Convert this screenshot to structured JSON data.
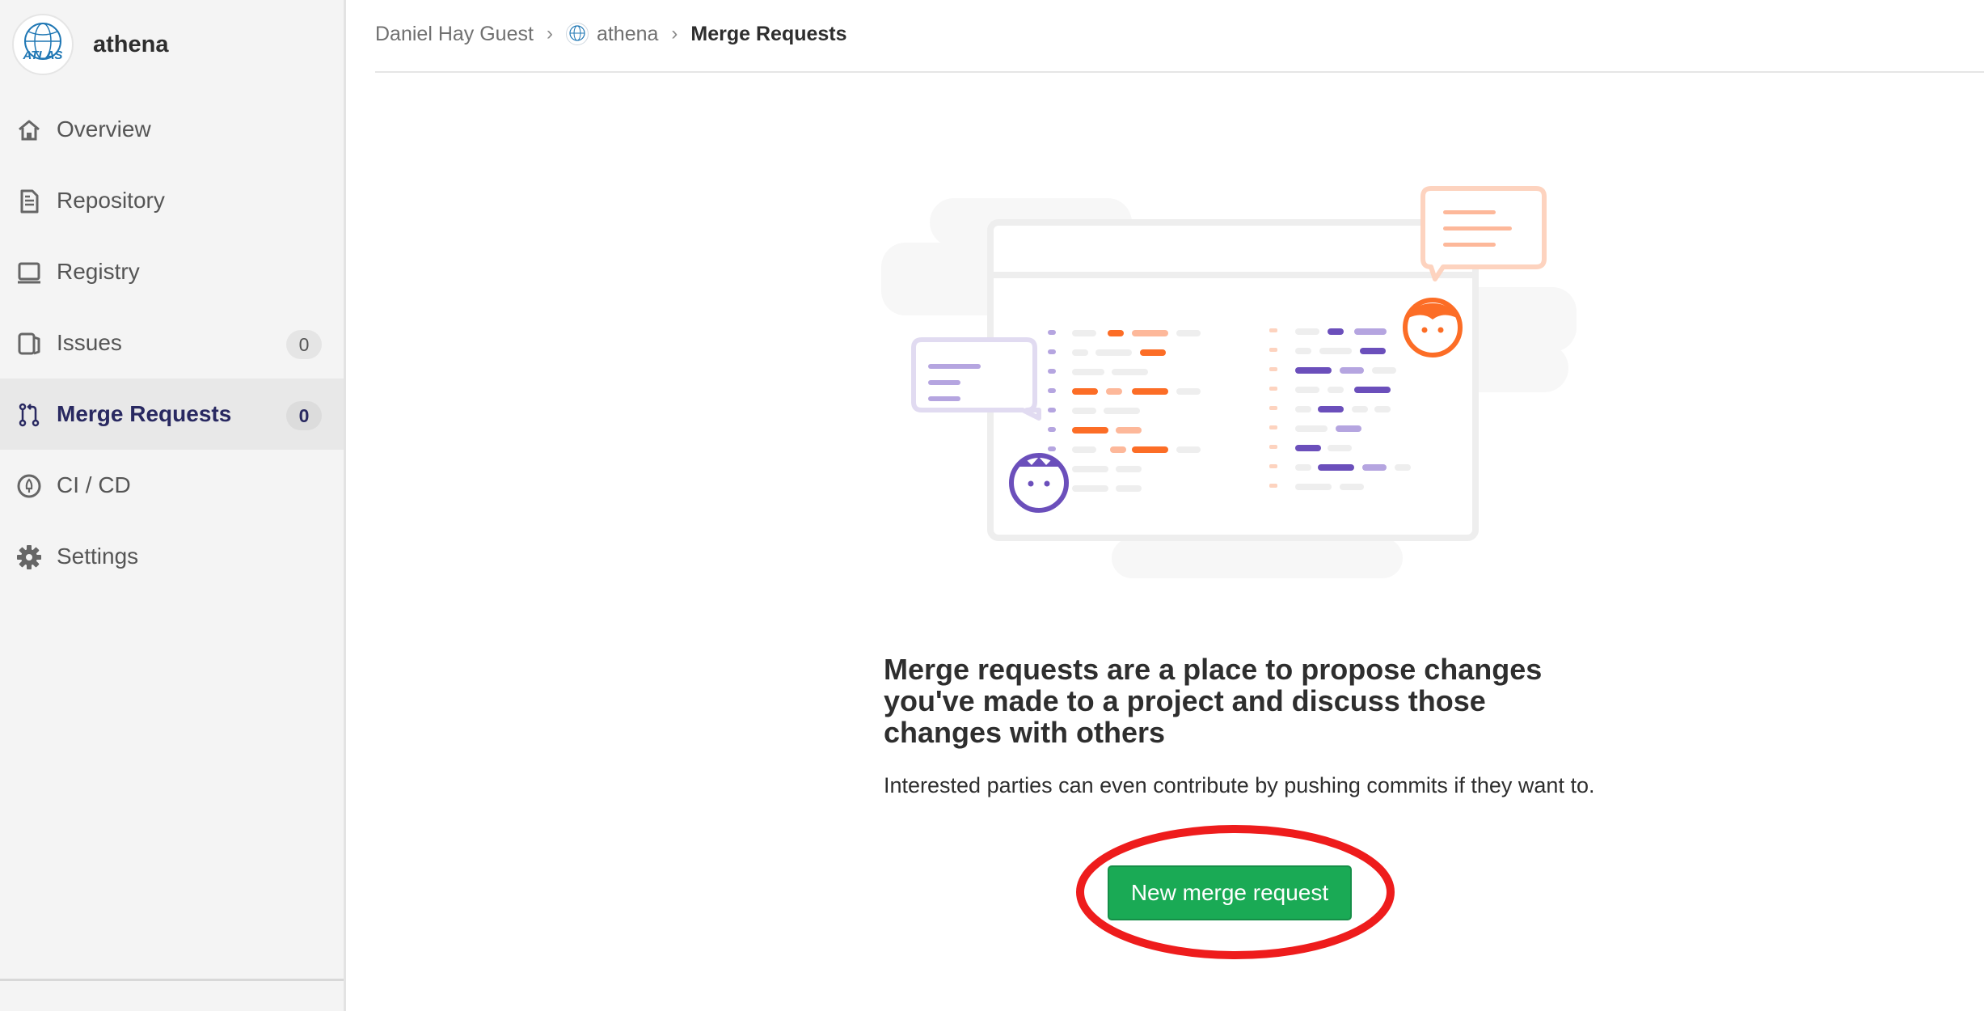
{
  "project": {
    "name": "athena",
    "logo_text": "ATLAS"
  },
  "sidebar": {
    "items": [
      {
        "label": "Overview",
        "icon": "home-icon"
      },
      {
        "label": "Repository",
        "icon": "document-icon"
      },
      {
        "label": "Registry",
        "icon": "container-icon"
      },
      {
        "label": "Issues",
        "icon": "issues-icon",
        "count": "0"
      },
      {
        "label": "Merge Requests",
        "icon": "merge-request-icon",
        "count": "0",
        "active": true
      },
      {
        "label": "CI / CD",
        "icon": "rocket-icon"
      },
      {
        "label": "Settings",
        "icon": "gear-icon"
      }
    ]
  },
  "breadcrumb": {
    "items": [
      "Daniel Hay Guest",
      "athena",
      "Merge Requests"
    ]
  },
  "empty_state": {
    "title": "Merge requests are a place to propose changes you've made to a project and discuss those changes with others",
    "description": "Interested parties can even contribute by pushing commits if they want to.",
    "button_label": "New merge request"
  },
  "colors": {
    "primary_button": "#1aaa55",
    "active_nav_text": "#292961",
    "annotation_ring": "#ee1c1c",
    "illustration_orange": "#fc6d26",
    "illustration_purple": "#6b4fbb"
  }
}
